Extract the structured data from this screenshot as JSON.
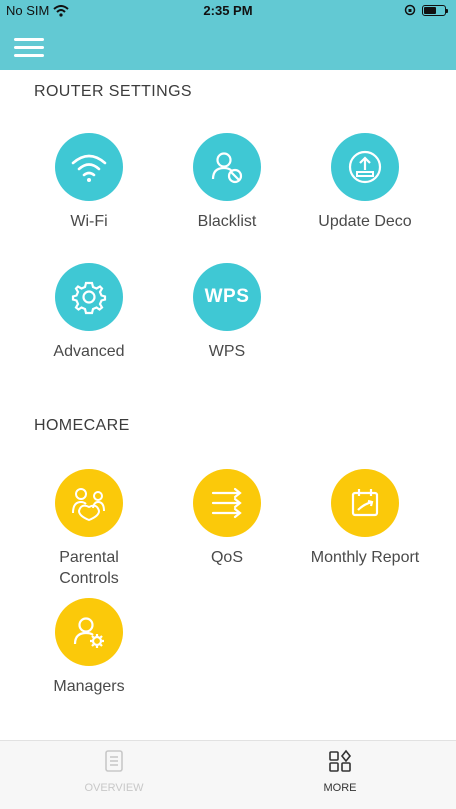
{
  "status_bar": {
    "carrier": "No SIM",
    "time": "2:35 PM",
    "battery_level": 0.6
  },
  "router_settings": {
    "title": "ROUTER SETTINGS",
    "items": [
      {
        "label": "Wi-Fi",
        "icon": "wifi-icon"
      },
      {
        "label": "Blacklist",
        "icon": "blacklist-user-icon"
      },
      {
        "label": "Update Deco",
        "icon": "upload-icon"
      },
      {
        "label": "Advanced",
        "icon": "gear-icon"
      },
      {
        "label": "WPS",
        "icon": "wps-icon",
        "icon_text": "WPS"
      }
    ]
  },
  "homecare": {
    "title": "HOMECARE",
    "items": [
      {
        "label": "Parental Controls",
        "icon": "parental-controls-icon"
      },
      {
        "label": "QoS",
        "icon": "qos-icon"
      },
      {
        "label": "Monthly Report",
        "icon": "calendar-report-icon"
      },
      {
        "label": "Managers",
        "icon": "manager-user-icon"
      }
    ]
  },
  "bottom_nav": {
    "items": [
      {
        "label": "OVERVIEW",
        "icon": "overview-document-icon",
        "active": false
      },
      {
        "label": "MORE",
        "icon": "more-grid-icon",
        "active": true
      }
    ]
  },
  "colors": {
    "header": "#62c9d3",
    "teal_icon": "#3fc8d4",
    "gold_icon": "#fbc90a"
  }
}
